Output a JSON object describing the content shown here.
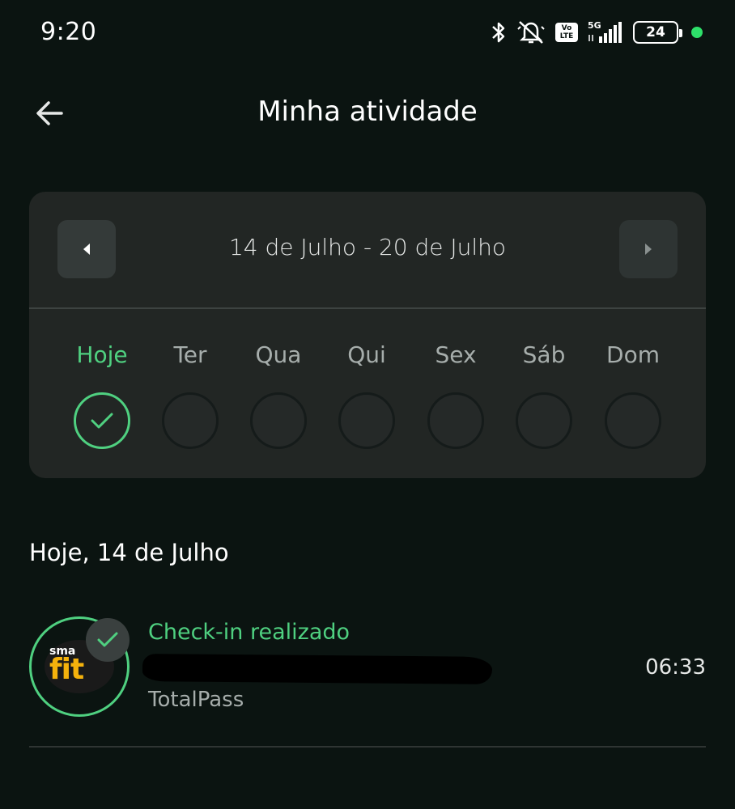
{
  "status_bar": {
    "time": "9:20",
    "battery": "24",
    "network": "5G",
    "volte": "Vo LTE",
    "icons": [
      "bluetooth-icon",
      "bell-muted-icon",
      "volte-icon",
      "signal-5g-icon",
      "battery-icon",
      "green-dot-indicator"
    ]
  },
  "header": {
    "title": "Minha atividade",
    "back_icon": "arrow-left-icon"
  },
  "week": {
    "range": "14 de Julho - 20 de Julho",
    "prev_icon": "caret-left-icon",
    "next_icon": "caret-right-icon",
    "days": [
      {
        "label": "Hoje",
        "done": true
      },
      {
        "label": "Ter",
        "done": false
      },
      {
        "label": "Qua",
        "done": false
      },
      {
        "label": "Qui",
        "done": false
      },
      {
        "label": "Sex",
        "done": false
      },
      {
        "label": "Sáb",
        "done": false
      },
      {
        "label": "Dom",
        "done": false
      }
    ]
  },
  "section": {
    "date_title": "Hoje, 14 de Julho"
  },
  "activity": {
    "status": "Check-in realizado",
    "provider": "TotalPass",
    "time": "06:33",
    "logo_text_top": "sma",
    "logo_text_main": "fit"
  },
  "colors": {
    "background": "#0b1411",
    "card": "#222624",
    "accent_green": "#4fd080",
    "muted_text": "#a6adab",
    "logo_yellow": "#f4b20c"
  }
}
